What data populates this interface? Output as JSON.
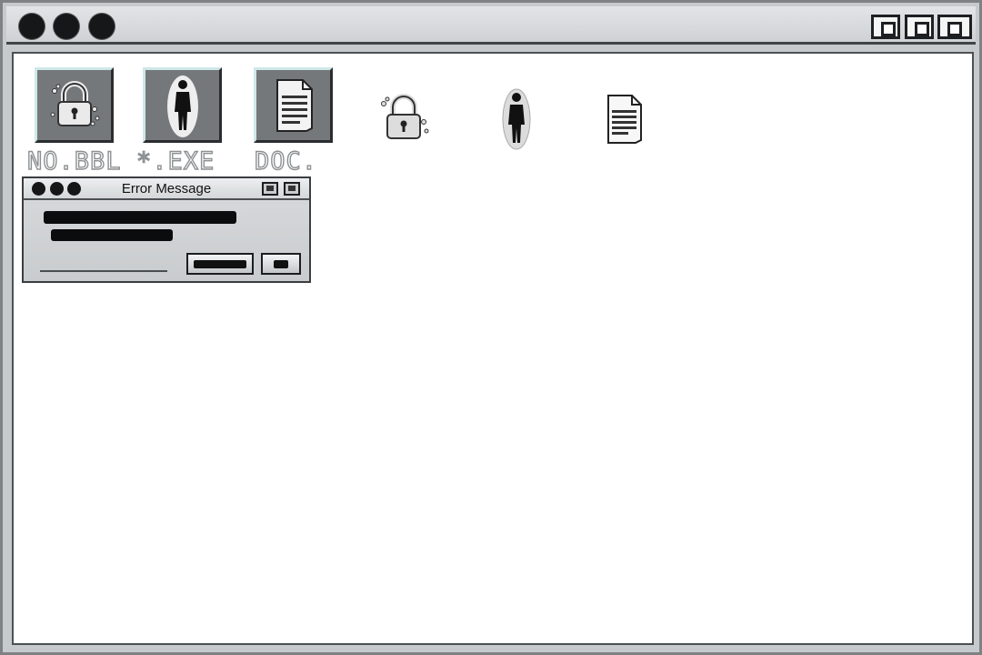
{
  "window": {
    "traffic_lights": [
      "close",
      "minimize",
      "zoom"
    ],
    "controls": [
      "window-control-1",
      "window-control-2",
      "window-control-3"
    ]
  },
  "desktop": {
    "icon_labels": {
      "lock": "NO.BBL",
      "person": "*.EXE",
      "document": "DOC."
    },
    "icons": [
      "lock-icon",
      "person-icon",
      "document-icon"
    ]
  },
  "dialog": {
    "title": "Error Message"
  },
  "colors": {
    "window_frame": "#c7cacd",
    "content_bg": "#ffffff",
    "tile_bg": "#75787b",
    "tile_highlight": "#cfe8ea"
  }
}
